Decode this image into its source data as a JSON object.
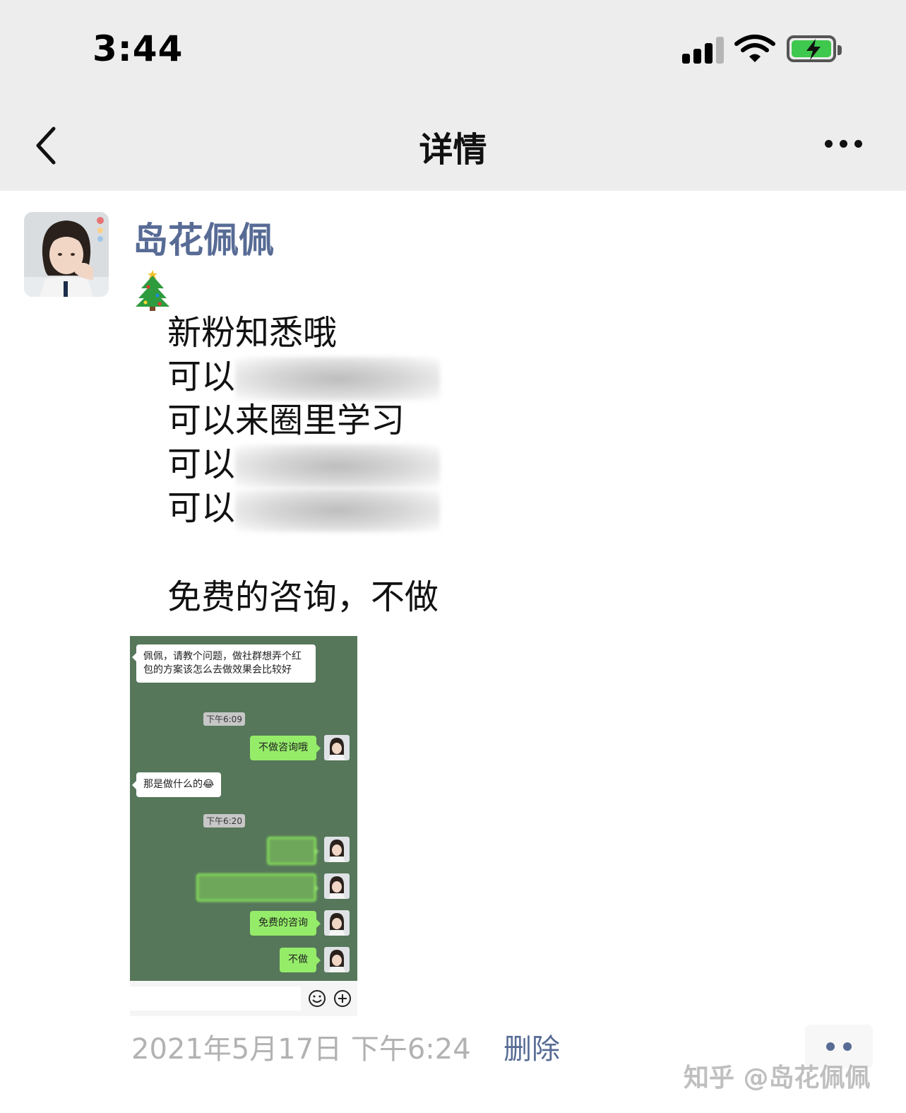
{
  "status_bar": {
    "time": "3:44"
  },
  "nav": {
    "title": "详情"
  },
  "post": {
    "author": "岛花佩佩",
    "lines": [
      "新粉知悉哦",
      "可以",
      "可以来圈里学习",
      "可以",
      "可以",
      "免费的咨询，不做"
    ],
    "date": "2021年5月17日 下午6:24",
    "delete_label": "删除"
  },
  "screenshot": {
    "messages": {
      "q1": "佩佩，请教个问题，做社群想弄个红包的方案该怎么去做效果会比较好",
      "time1": "下午6:09",
      "r1": "不做咨询哦",
      "q2": "那是做什么的😂",
      "time2": "下午6:20",
      "r4": "免费的咨询",
      "r5": "不做"
    }
  },
  "watermark": "知乎 @岛花佩佩",
  "colors": {
    "link": "#576b95",
    "chat_bg": "#56775a",
    "bubble_green": "#95ec69",
    "battery_green": "#3ec84d"
  }
}
